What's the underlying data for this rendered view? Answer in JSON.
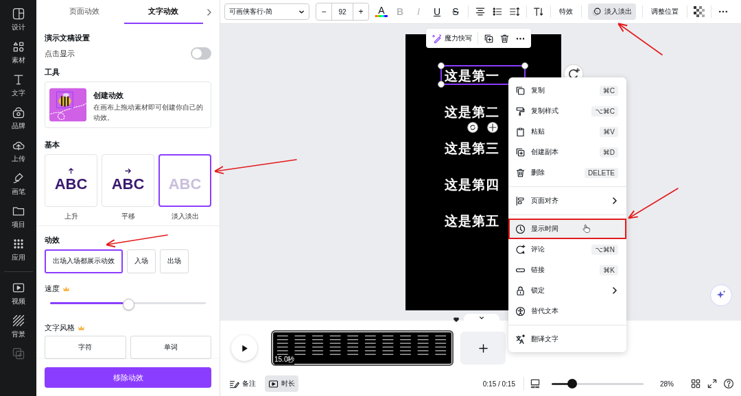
{
  "rail": {
    "items": [
      {
        "label": "设计"
      },
      {
        "label": "素材"
      },
      {
        "label": "文字"
      },
      {
        "label": "品牌"
      },
      {
        "label": "上传"
      },
      {
        "label": "画笔"
      },
      {
        "label": "项目"
      },
      {
        "label": "应用"
      },
      {
        "label": "视频"
      },
      {
        "label": "背景"
      }
    ]
  },
  "panel": {
    "tabs": [
      {
        "label": "页面动效",
        "selected": false
      },
      {
        "label": "文字动效",
        "selected": true
      }
    ],
    "presentation": {
      "heading": "演示文稿设置",
      "toggle_label": "点击显示",
      "on": false
    },
    "tools": {
      "heading": "工具",
      "card_title": "创建动效",
      "card_text": "在画布上拖动素材即可创建你自己的动效。"
    },
    "basic": {
      "heading": "基本",
      "presets": [
        {
          "preview": "ABC",
          "label": "上升",
          "kind": "rise",
          "selected": false
        },
        {
          "preview": "ABC",
          "label": "平移",
          "kind": "pan",
          "selected": false
        },
        {
          "preview": "ABC",
          "label": "淡入淡出",
          "kind": "fade",
          "selected": true
        }
      ]
    },
    "effect": {
      "heading": "动效",
      "options": [
        {
          "label": "出场入场都展示动效",
          "selected": true
        },
        {
          "label": "入场",
          "selected": false
        },
        {
          "label": "出场",
          "selected": false
        }
      ]
    },
    "speed": {
      "heading": "速度",
      "premium": true,
      "level": 0.47
    },
    "text_style": {
      "heading": "文字风格",
      "premium": true,
      "options": [
        {
          "label": "字符",
          "selected": false
        },
        {
          "label": "单词",
          "selected": false
        }
      ]
    },
    "remove_button": "移除动效"
  },
  "toolbar": {
    "font": "可画侠客行-简",
    "minus": "−",
    "size": "92",
    "plus": "+",
    "format": [
      {
        "label": "A",
        "kind": "color",
        "disabled": false
      },
      {
        "label": "B",
        "kind": "bold",
        "disabled": true
      },
      {
        "label": "I",
        "kind": "italic",
        "disabled": true
      },
      {
        "label": "U",
        "kind": "underline",
        "disabled": false
      },
      {
        "label": "S",
        "kind": "strike",
        "disabled": false
      }
    ],
    "effects": "特效",
    "animate": {
      "label": "淡入淡出",
      "selected": true
    },
    "position": "调整位置"
  },
  "canvas": {
    "float_label": "魔力快写",
    "lines": [
      {
        "text": "这是第一",
        "selected": true
      },
      {
        "text": "这是第二",
        "selected": false
      },
      {
        "text": "这是第三",
        "selected": false
      },
      {
        "text": "这是第四",
        "selected": false
      },
      {
        "text": "这是第五",
        "selected": false
      }
    ]
  },
  "context_menu": {
    "groups": [
      [
        {
          "label": "复制",
          "shortcut": "⌘C",
          "submenu": false,
          "highlighted": false
        },
        {
          "label": "复制样式",
          "shortcut": "⌥⌘C",
          "submenu": false,
          "highlighted": false
        },
        {
          "label": "粘贴",
          "shortcut": "⌘V",
          "submenu": false,
          "highlighted": false
        },
        {
          "label": "创建副本",
          "shortcut": "⌘D",
          "submenu": false,
          "highlighted": false
        },
        {
          "label": "删除",
          "shortcut": "DELETE",
          "submenu": false,
          "highlighted": false
        }
      ],
      [
        {
          "label": "页面对齐",
          "submenu": true,
          "highlighted": false
        }
      ],
      [
        {
          "label": "显示时间",
          "submenu": false,
          "highlighted": true
        },
        {
          "label": "评论",
          "shortcut": "⌥⌘N",
          "submenu": false,
          "highlighted": false
        },
        {
          "label": "链接",
          "shortcut": "⌘K",
          "submenu": false,
          "highlighted": false
        },
        {
          "label": "锁定",
          "submenu": true,
          "highlighted": false
        },
        {
          "label": "替代文本",
          "submenu": false,
          "highlighted": false
        }
      ],
      [
        {
          "label": "翻译文字",
          "submenu": false,
          "highlighted": false
        }
      ]
    ]
  },
  "timeline": {
    "duration_badge": "15.0秒",
    "buttons": [
      {
        "label": "备注",
        "selected": false
      },
      {
        "label": "时长",
        "selected": true
      }
    ],
    "time": "0:15 / 0:15",
    "zoom": {
      "level": 0.2,
      "reading": "28%"
    }
  }
}
